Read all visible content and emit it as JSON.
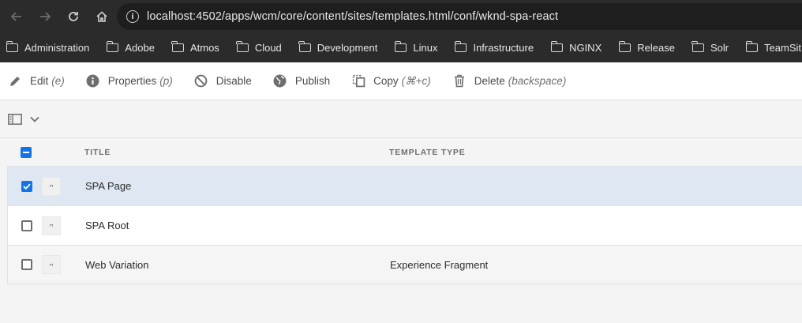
{
  "browser": {
    "url": "localhost:4502/apps/wcm/core/content/sites/templates.html/conf/wknd-spa-react",
    "bookmarks": [
      "Administration",
      "Adobe",
      "Atmos",
      "Cloud",
      "Development",
      "Linux",
      "Infrastructure",
      "NGINX",
      "Release",
      "Solr",
      "TeamSit"
    ]
  },
  "actions": [
    {
      "label": "Edit",
      "hint": "(e)",
      "icon": "pencil-icon"
    },
    {
      "label": "Properties",
      "hint": "(p)",
      "icon": "info-icon"
    },
    {
      "label": "Disable",
      "hint": "",
      "icon": "disable-icon"
    },
    {
      "label": "Publish",
      "hint": "",
      "icon": "globe-icon"
    },
    {
      "label": "Copy",
      "hint": "(⌘+c)",
      "icon": "copy-icon"
    },
    {
      "label": "Delete",
      "hint": "(backspace)",
      "icon": "trash-icon"
    }
  ],
  "table": {
    "headers": {
      "title": "TITLE",
      "template_type": "TEMPLATE TYPE"
    },
    "rows": [
      {
        "title": "SPA Page",
        "template_type": "",
        "selected": true
      },
      {
        "title": "SPA Root",
        "template_type": "",
        "selected": false
      },
      {
        "title": "Web Variation",
        "template_type": "Experience Fragment",
        "selected": false
      }
    ]
  },
  "colors": {
    "accent": "#1473e6",
    "selected_row": "#dfe7f3",
    "browser_chrome": "#2b2b2b"
  }
}
